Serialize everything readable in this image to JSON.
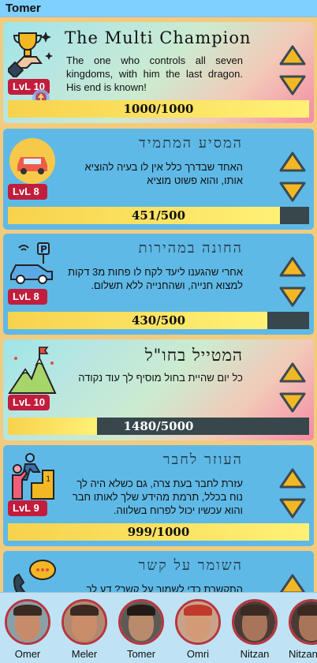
{
  "app": {
    "title": "Tomer"
  },
  "achievements": [
    {
      "title": "The Multi Champion",
      "description": "The one who controls all seven kingdoms, with him the last dragon. His end is known!",
      "level_prefix": "LvL",
      "level": "10",
      "progress_text": "1000/1000",
      "progress": 1.0,
      "icon": "trophy-hand-icon",
      "dir": "ltr"
    },
    {
      "title": "המסיע המתמיד",
      "description": "האחד שבדרך כלל אין לו בעיה להוציא אותו, והוא פשוט מוציא",
      "level_prefix": "LvL",
      "level": "8",
      "progress_text": "451/500",
      "progress": 0.902,
      "icon": "car-icon",
      "dir": "rtl"
    },
    {
      "title": "החונה במהירות",
      "description": "אחרי שהגענו ליעד לקח לו פחות מ3 דקות למצוא חנייה, ושהחנייה ללא תשלום.",
      "level_prefix": "LvL",
      "level": "8",
      "progress_text": "430/500",
      "progress": 0.86,
      "icon": "parking-car-icon",
      "dir": "rtl"
    },
    {
      "title": "המטייל בחו\"ל",
      "description": "כל יום שהיית בחול מוסיף לך עוד נקודה",
      "level_prefix": "LvL",
      "level": "10",
      "progress_text": "1480/5000",
      "progress": 0.296,
      "icon": "mountain-flag-icon",
      "dir": "rtl"
    },
    {
      "title": "העוזר לחבר",
      "description": "עזרת לחבר בעת צרה, גם כשלא היה לך נוח בכלל, תרמת מהידע שלך לאותו חבר והוא עכשיו יכול לפרוח בשלווה.",
      "level_prefix": "LvL",
      "level": "9",
      "progress_text": "999/1000",
      "progress": 0.999,
      "icon": "climbing-help-icon",
      "dir": "rtl"
    },
    {
      "title": "השומר על קשר",
      "description": "התקשרת כדי לשמור על קשר? דע לך",
      "level_prefix": "LvL",
      "level": "",
      "progress_text": "",
      "progress": 0,
      "icon": "phone-chat-icon",
      "dir": "rtl"
    }
  ],
  "friends": [
    {
      "name": "Omer"
    },
    {
      "name": "Meler"
    },
    {
      "name": "Tomer"
    },
    {
      "name": "Omri"
    },
    {
      "name": "Nitzan"
    },
    {
      "name": "Nitzan"
    }
  ],
  "colors": {
    "card": "#5fb9e6",
    "level_badge": "#c21d3c",
    "progress_fill": "#f7d24d",
    "progress_track": "#37474c",
    "arrow_fill": "#f2b824",
    "arrow_stroke": "#3b4a55"
  }
}
